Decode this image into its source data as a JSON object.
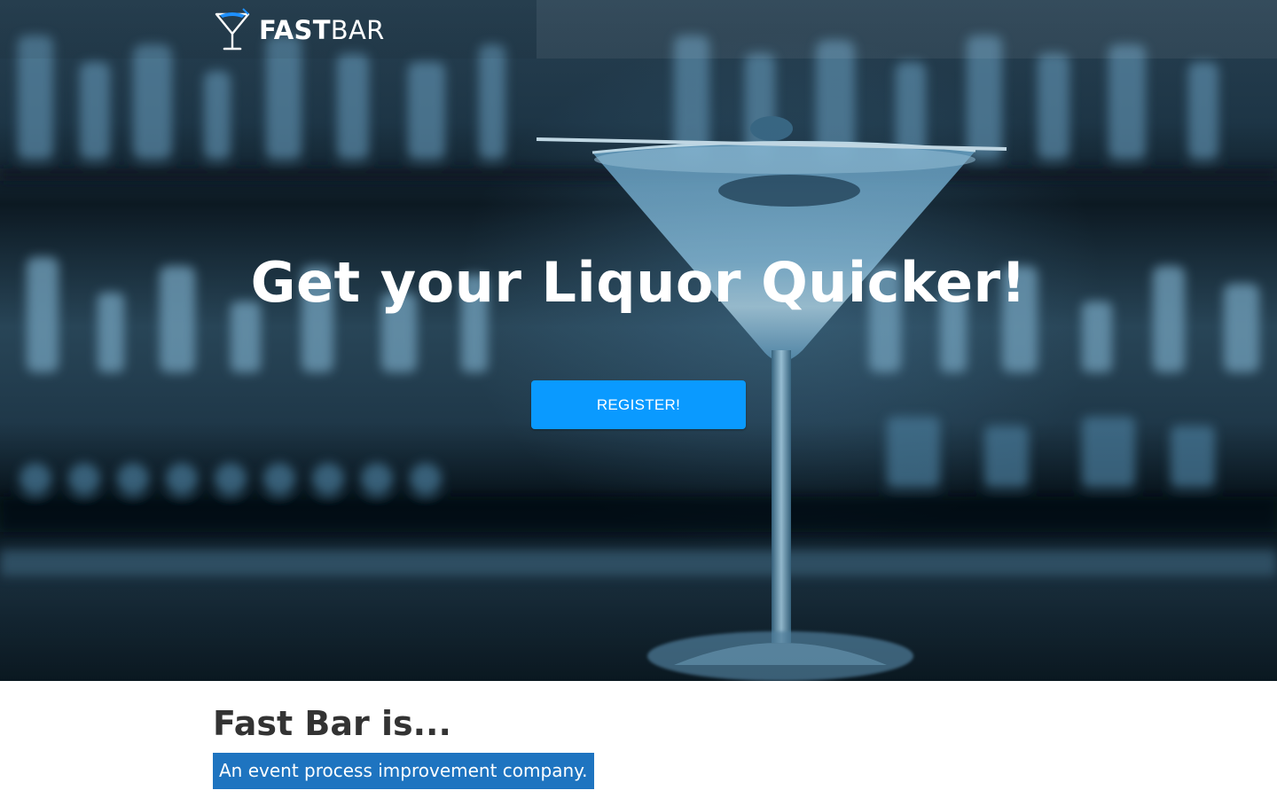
{
  "brand": {
    "name_bold": "FAST",
    "name_light": "BAR",
    "logo_icon": "martini-glass-icon",
    "accent_color": "#1e90ff"
  },
  "hero": {
    "headline": "Get your Liquor Quicker!",
    "register_label": "REGISTER!",
    "button_color": "#0a9aff"
  },
  "about": {
    "title": "Fast Bar is...",
    "tagline": "An event process improvement company.",
    "tagline_bg": "#1e74c0"
  }
}
